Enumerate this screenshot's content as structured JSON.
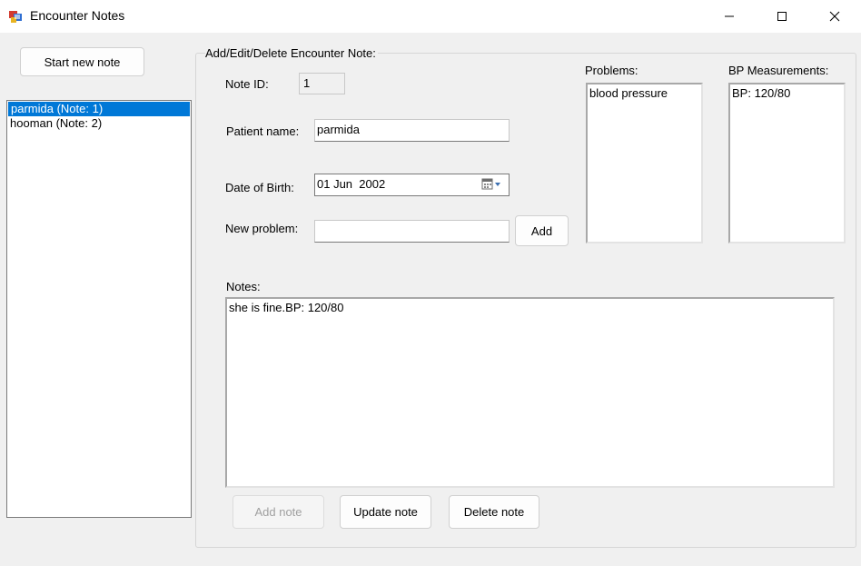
{
  "window": {
    "title": "Encounter Notes"
  },
  "sidebar": {
    "start_new_note_label": "Start new note",
    "notes_list": [
      {
        "label": "parmida (Note: 1)",
        "selected": true
      },
      {
        "label": "hooman (Note: 2)",
        "selected": false
      }
    ]
  },
  "form": {
    "group_title": "Add/Edit/Delete Encounter Note:",
    "note_id_label": "Note ID:",
    "note_id_value": "1",
    "patient_name_label": "Patient name:",
    "patient_name_value": "parmida",
    "dob_label": "Date of Birth:",
    "dob_value": "01 Jun  2002",
    "new_problem_label": "New problem:",
    "new_problem_value": "",
    "add_label": "Add",
    "problems_label": "Problems:",
    "problems_list": [
      "blood pressure"
    ],
    "bp_label": "BP Measurements:",
    "bp_list": [
      "BP: 120/80"
    ],
    "notes_label": "Notes:",
    "notes_value": "she is fine.BP: 120/80",
    "add_note_label": "Add note",
    "add_note_enabled": false,
    "update_note_label": "Update note",
    "delete_note_label": "Delete note"
  },
  "colors": {
    "selection": "#0078d7",
    "window_bg": "#f0f0f0"
  }
}
